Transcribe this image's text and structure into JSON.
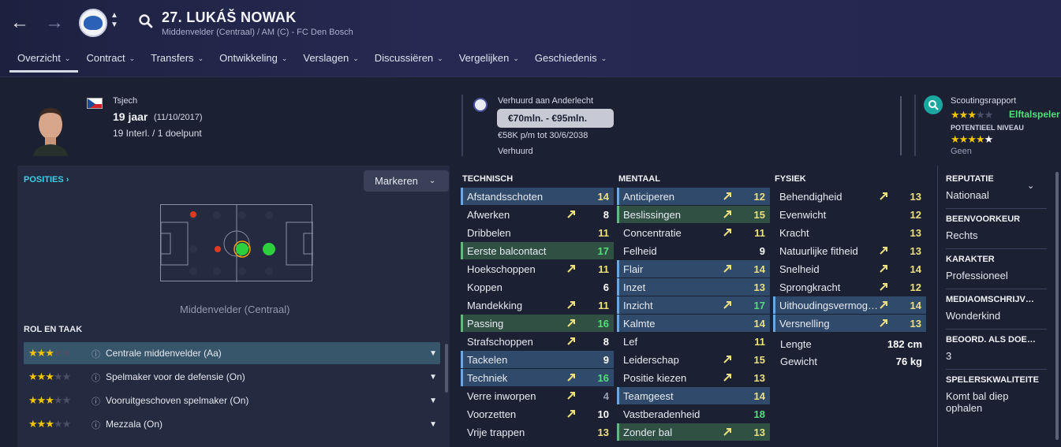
{
  "header": {
    "title": "27. LUKÁŠ NOWAK",
    "subtitle": "Middenvelder (Centraal) / AM (C) - FC Den Bosch",
    "tabs": [
      {
        "label": "Overzicht",
        "active": true
      },
      {
        "label": "Contract"
      },
      {
        "label": "Transfers"
      },
      {
        "label": "Ontwikkeling"
      },
      {
        "label": "Verslagen"
      },
      {
        "label": "Discussiëren"
      },
      {
        "label": "Vergelijken"
      },
      {
        "label": "Geschiedenis"
      }
    ]
  },
  "profile": {
    "nationality": "Tsjech",
    "age": "19 jaar",
    "dob": "(11/10/2017)",
    "caps": "19 Interl. / 1 doelpunt"
  },
  "contract": {
    "loan": "Verhuurd aan Anderlecht",
    "value": "€70mln. - €95mln.",
    "wage": "€58K p/m tot 30/6/2038",
    "status": "Verhuurd"
  },
  "scouting": {
    "title": "Scoutingsrapport",
    "current_label": "Elftalspeler",
    "current_stars": 3,
    "potential_title": "POTENTIEEL NIVEAU",
    "potential_stars": 4.5,
    "note": "Geen"
  },
  "positions": {
    "label": "POSITIES",
    "mark_button": "Markeren",
    "caption": "Middenvelder (Centraal)",
    "role_title": "ROL EN TAAK",
    "roles": [
      {
        "name": "Centrale middenvelder (Aa)",
        "stars": 3,
        "selected": true
      },
      {
        "name": "Spelmaker voor de defensie (On)",
        "stars": 3
      },
      {
        "name": "Vooruitgeschoven spelmaker (On)",
        "stars": 3
      },
      {
        "name": "Mezzala (On)",
        "stars": 3
      }
    ]
  },
  "technical": {
    "title": "TECHNISCH",
    "attrs": [
      {
        "name": "Afstandsschoten",
        "value": "14",
        "hl": "hb",
        "arrow": false
      },
      {
        "name": "Afwerken",
        "value": "8",
        "arrow": true
      },
      {
        "name": "Dribbelen",
        "value": "11",
        "arrow": false
      },
      {
        "name": "Eerste balcontact",
        "value": "17",
        "hl": "hg",
        "arrow": false
      },
      {
        "name": "Hoekschoppen",
        "value": "11",
        "arrow": true
      },
      {
        "name": "Koppen",
        "value": "6",
        "arrow": false
      },
      {
        "name": "Mandekking",
        "value": "11",
        "arrow": true
      },
      {
        "name": "Passing",
        "value": "16",
        "hl": "hg",
        "arrow": true
      },
      {
        "name": "Strafschoppen",
        "value": "8",
        "arrow": true
      },
      {
        "name": "Tackelen",
        "value": "9",
        "hl": "hb",
        "arrow": false
      },
      {
        "name": "Techniek",
        "value": "16",
        "hl": "hb",
        "arrow": true
      },
      {
        "name": "Verre inworpen",
        "value": "4",
        "arrow": true
      },
      {
        "name": "Voorzetten",
        "value": "10",
        "arrow": true
      },
      {
        "name": "Vrije trappen",
        "value": "13",
        "arrow": false
      }
    ]
  },
  "mental": {
    "title": "MENTAAL",
    "attrs": [
      {
        "name": "Anticiperen",
        "value": "12",
        "hl": "hb",
        "arrow": true
      },
      {
        "name": "Beslissingen",
        "value": "15",
        "hl": "hg",
        "arrow": true
      },
      {
        "name": "Concentratie",
        "value": "11",
        "arrow": true
      },
      {
        "name": "Felheid",
        "value": "9",
        "arrow": false
      },
      {
        "name": "Flair",
        "value": "14",
        "hl": "hb",
        "arrow": true
      },
      {
        "name": "Inzet",
        "value": "13",
        "hl": "hb",
        "arrow": false
      },
      {
        "name": "Inzicht",
        "value": "17",
        "hl": "hb",
        "arrow": true
      },
      {
        "name": "Kalmte",
        "value": "14",
        "hl": "hb",
        "arrow": false
      },
      {
        "name": "Lef",
        "value": "11",
        "arrow": false
      },
      {
        "name": "Leiderschap",
        "value": "15",
        "arrow": true
      },
      {
        "name": "Positie kiezen",
        "value": "13",
        "arrow": true
      },
      {
        "name": "Teamgeest",
        "value": "14",
        "hl": "hb",
        "arrow": false
      },
      {
        "name": "Vastberadenheid",
        "value": "18",
        "arrow": false
      },
      {
        "name": "Zonder bal",
        "value": "13",
        "hl": "hg",
        "arrow": true
      }
    ]
  },
  "physical": {
    "title": "FYSIEK",
    "attrs": [
      {
        "name": "Behendigheid",
        "value": "13",
        "arrow": true
      },
      {
        "name": "Evenwicht",
        "value": "12",
        "arrow": false
      },
      {
        "name": "Kracht",
        "value": "13",
        "arrow": false
      },
      {
        "name": "Natuurlijke fitheid",
        "value": "13",
        "arrow": true
      },
      {
        "name": "Snelheid",
        "value": "14",
        "arrow": true
      },
      {
        "name": "Sprongkracht",
        "value": "12",
        "arrow": true
      },
      {
        "name": "Uithoudingsvermog…",
        "value": "14",
        "hl": "hb",
        "arrow": true
      },
      {
        "name": "Versnelling",
        "value": "13",
        "hl": "hb",
        "arrow": true
      }
    ],
    "height_label": "Lengte",
    "height": "182 cm",
    "weight_label": "Gewicht",
    "weight": "76 kg"
  },
  "info_panel": [
    {
      "title": "REPUTATIE",
      "value": "Nationaal"
    },
    {
      "title": "BEENVOORKEUR",
      "value": "Rechts"
    },
    {
      "title": "KARAKTER",
      "value": "Professioneel"
    },
    {
      "title": "MEDIAOMSCHRIJV…",
      "value": "Wonderkind"
    },
    {
      "title": "BEOORD. ALS DOE…",
      "value": "3"
    },
    {
      "title": "SPELERSKWALITEITE",
      "value": "Komt bal diep ophalen"
    }
  ],
  "colors": {
    "accent_cyan": "#37d0e6",
    "value_green": "#53de7a",
    "value_yellow": "#ece07e",
    "star": "#f2c500"
  }
}
